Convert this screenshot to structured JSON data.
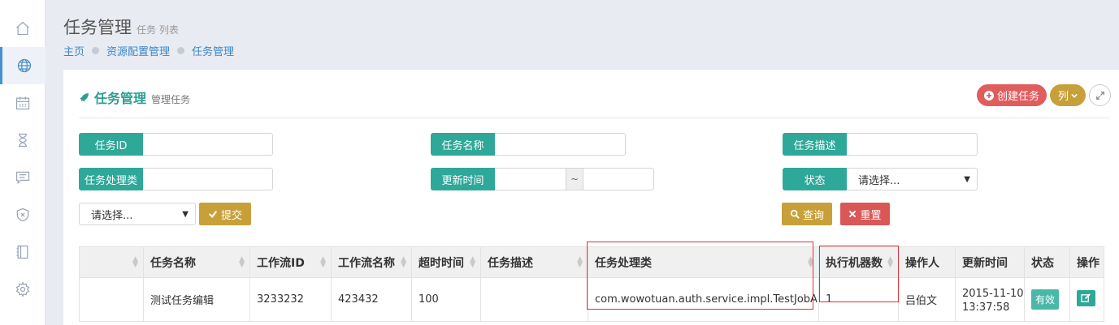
{
  "sidebar": {
    "items": [
      {
        "icon": "home-icon"
      },
      {
        "icon": "globe-icon",
        "active": true
      },
      {
        "icon": "calendar-icon"
      },
      {
        "icon": "hourglass-icon"
      },
      {
        "icon": "comment-icon"
      },
      {
        "icon": "shield-icon"
      },
      {
        "icon": "book-icon"
      },
      {
        "icon": "gear-icon"
      }
    ]
  },
  "header": {
    "title": "任务管理",
    "subtitle": "任务 列表",
    "breadcrumb": [
      "主页",
      "资源配置管理",
      "任务管理"
    ]
  },
  "panel": {
    "title": "任务管理",
    "subtitle": "管理任务",
    "create_label": "创建任务",
    "columns_label": "列"
  },
  "filters": {
    "task_id": {
      "label": "任务ID",
      "value": ""
    },
    "task_name": {
      "label": "任务名称",
      "value": ""
    },
    "task_desc": {
      "label": "任务描述",
      "value": ""
    },
    "task_handler": {
      "label": "任务处理类",
      "value": ""
    },
    "update_time": {
      "label": "更新时间",
      "from": "",
      "to": "",
      "separator": "~"
    },
    "status": {
      "label": "状态",
      "selected": "请选择..."
    },
    "batch_select": "请选择...",
    "submit_label": "提交",
    "query_label": "查询",
    "reset_label": "重置"
  },
  "table": {
    "headers": [
      "",
      "任务名称",
      "工作流ID",
      "工作流名称",
      "超时时间",
      "任务描述",
      "任务处理类",
      "执行机器数",
      "操作人",
      "更新时间",
      "状态",
      "操作"
    ],
    "rows": [
      {
        "task_name": "测试任务编辑",
        "workflow_id": "3233232",
        "workflow_name": "423432",
        "timeout": "100",
        "description": "",
        "handler": "com.wowotuan.auth.service.impl.TestJobA",
        "machine_count": "1",
        "operator": "吕伯文",
        "update_date": "2015-11-10",
        "update_time": "13:37:58",
        "status": "有效"
      }
    ]
  },
  "colors": {
    "teal": "#2ea899",
    "gold": "#c8a03a",
    "red": "#e05d5d",
    "link": "#3a87c8",
    "highlight": "#d9343b"
  }
}
